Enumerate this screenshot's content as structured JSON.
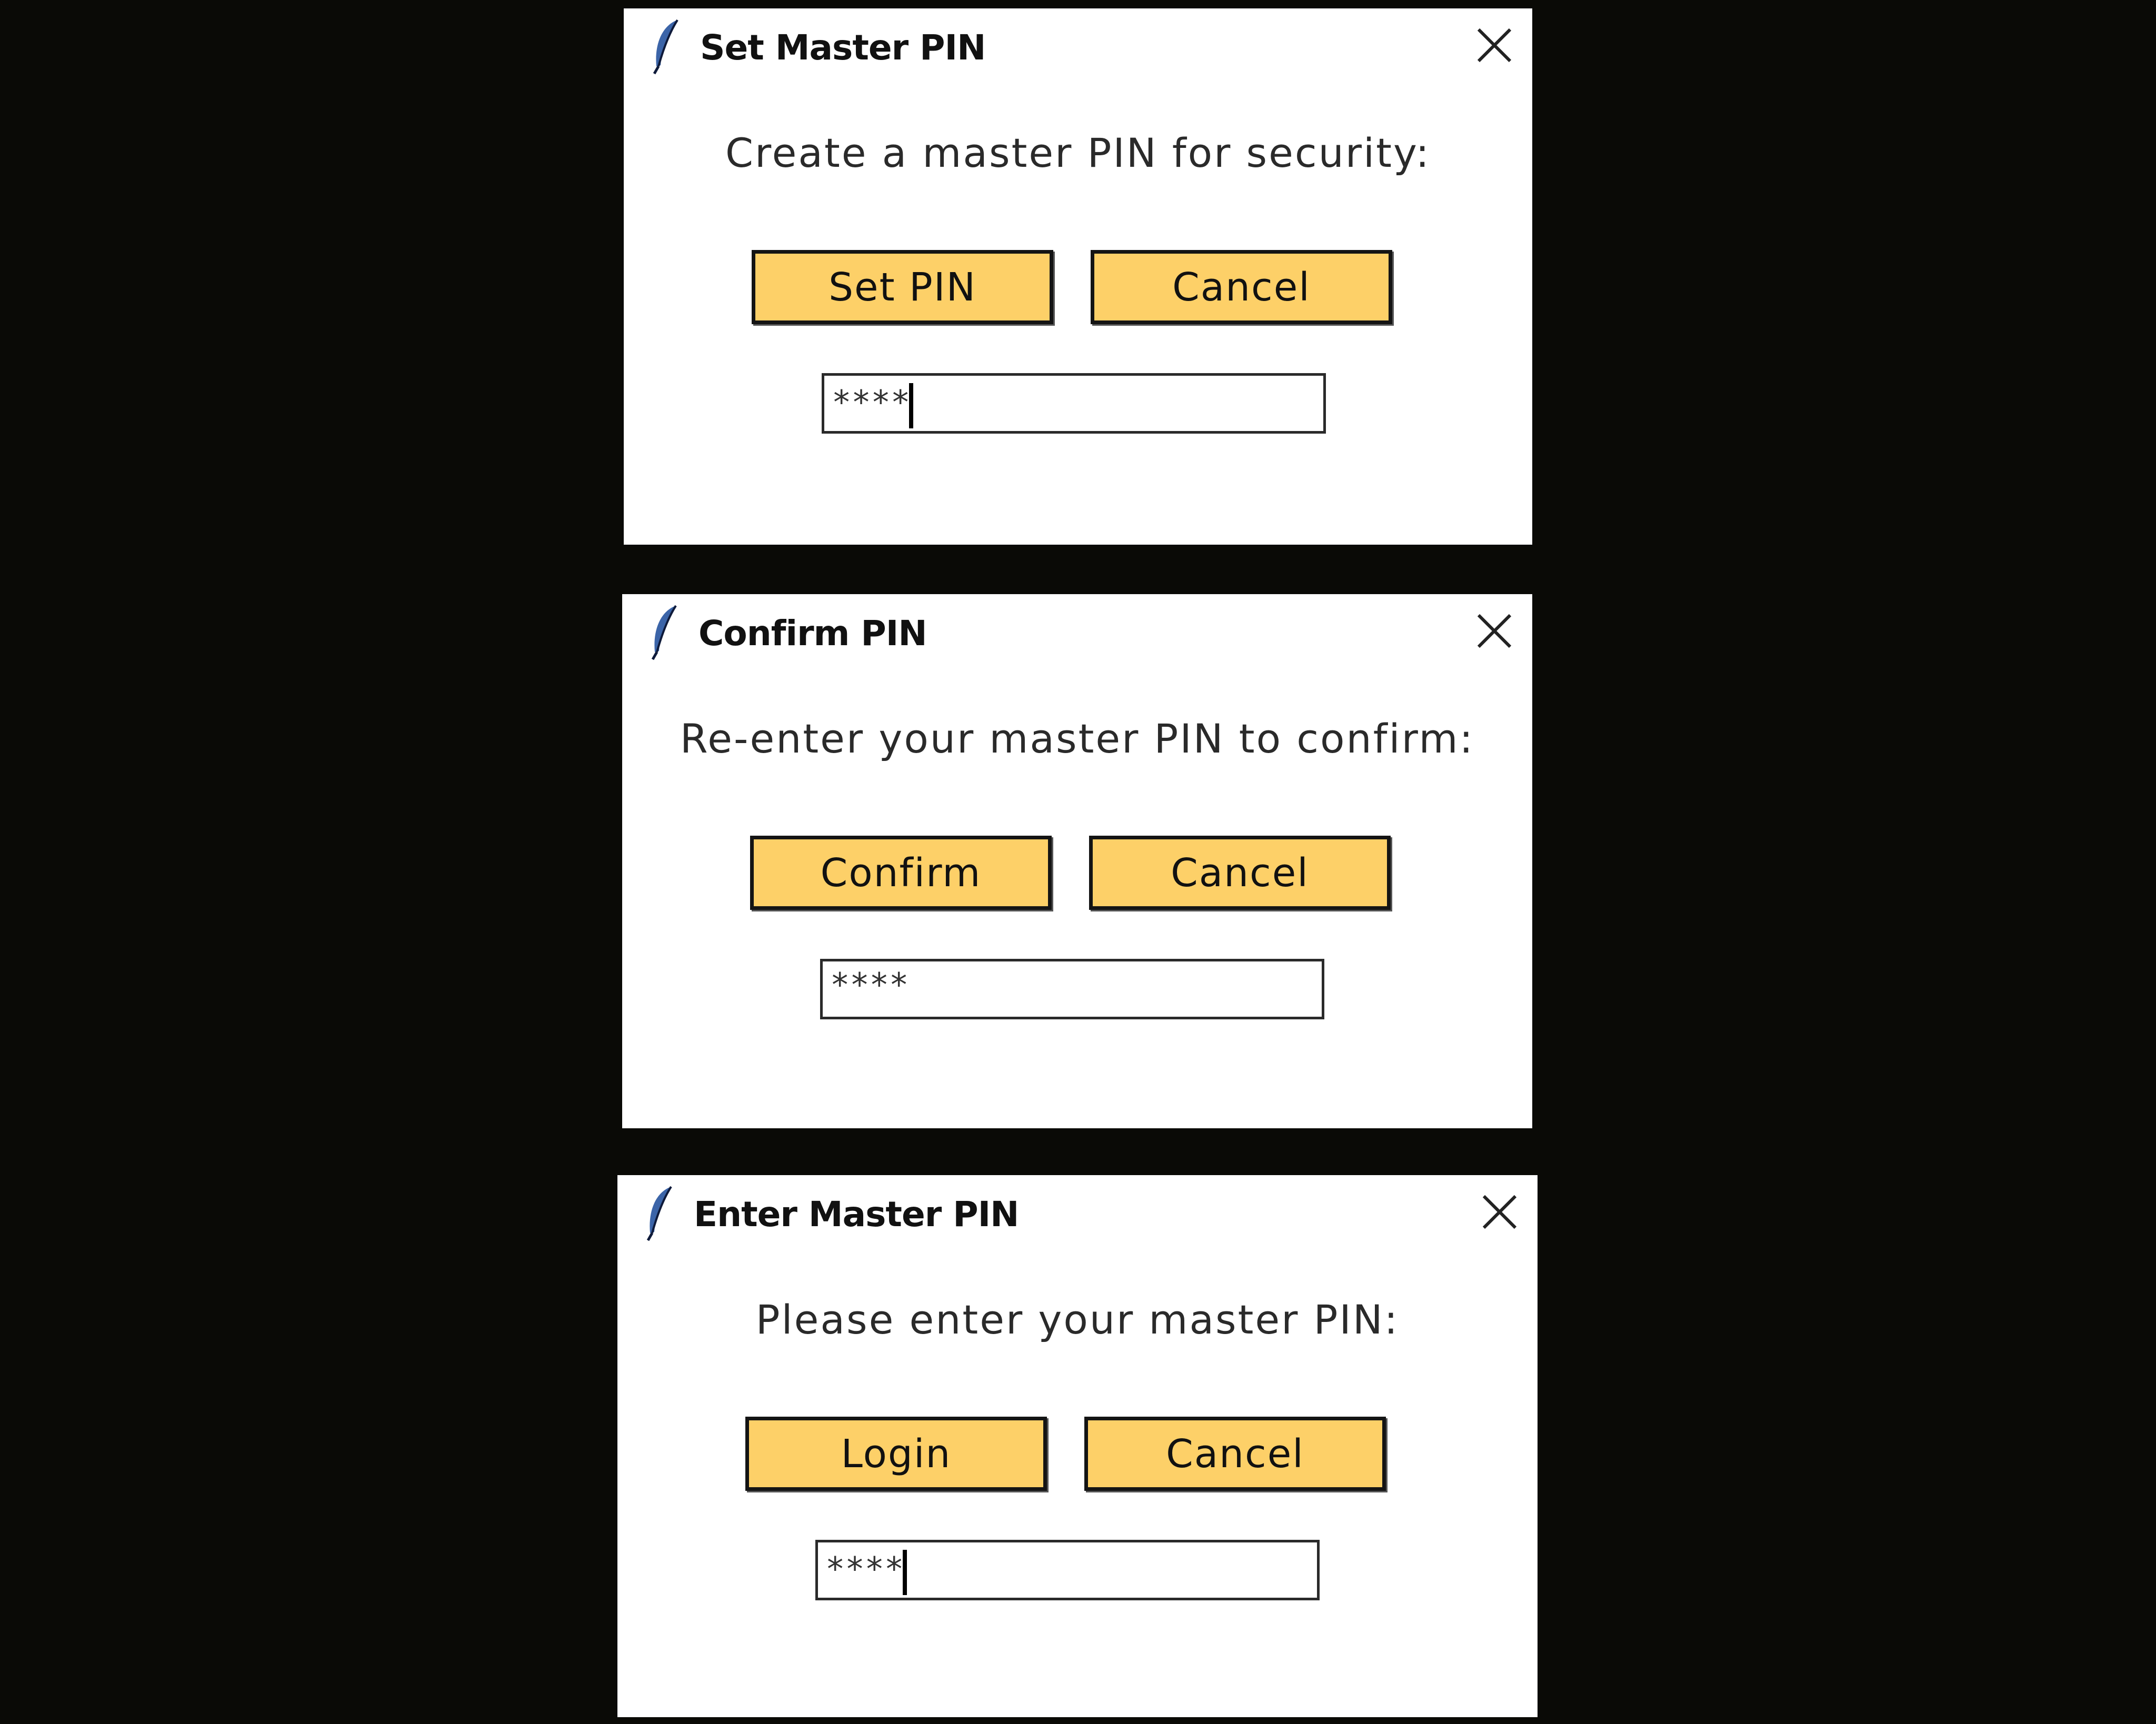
{
  "dialogs": [
    {
      "title": "Set Master PIN",
      "prompt": "Create a master PIN for security:",
      "primary_button": "Set PIN",
      "cancel_button": "Cancel",
      "pin_value": "****",
      "has_caret": true,
      "icons": {
        "app": "feather-icon",
        "close": "close-icon"
      }
    },
    {
      "title": "Confirm PIN",
      "prompt": "Re-enter your master PIN to confirm:",
      "primary_button": "Confirm",
      "cancel_button": "Cancel",
      "pin_value": "****",
      "has_caret": false,
      "icons": {
        "app": "feather-icon",
        "close": "close-icon"
      }
    },
    {
      "title": "Enter Master PIN",
      "prompt": "Please enter your master PIN:",
      "primary_button": "Login",
      "cancel_button": "Cancel",
      "pin_value": "****",
      "has_caret": true,
      "icons": {
        "app": "feather-icon",
        "close": "close-icon"
      }
    }
  ],
  "colors": {
    "background": "#0a0a06",
    "dialog": "#ffffff",
    "button_fill": "#fdd068",
    "button_border": "#141414"
  }
}
